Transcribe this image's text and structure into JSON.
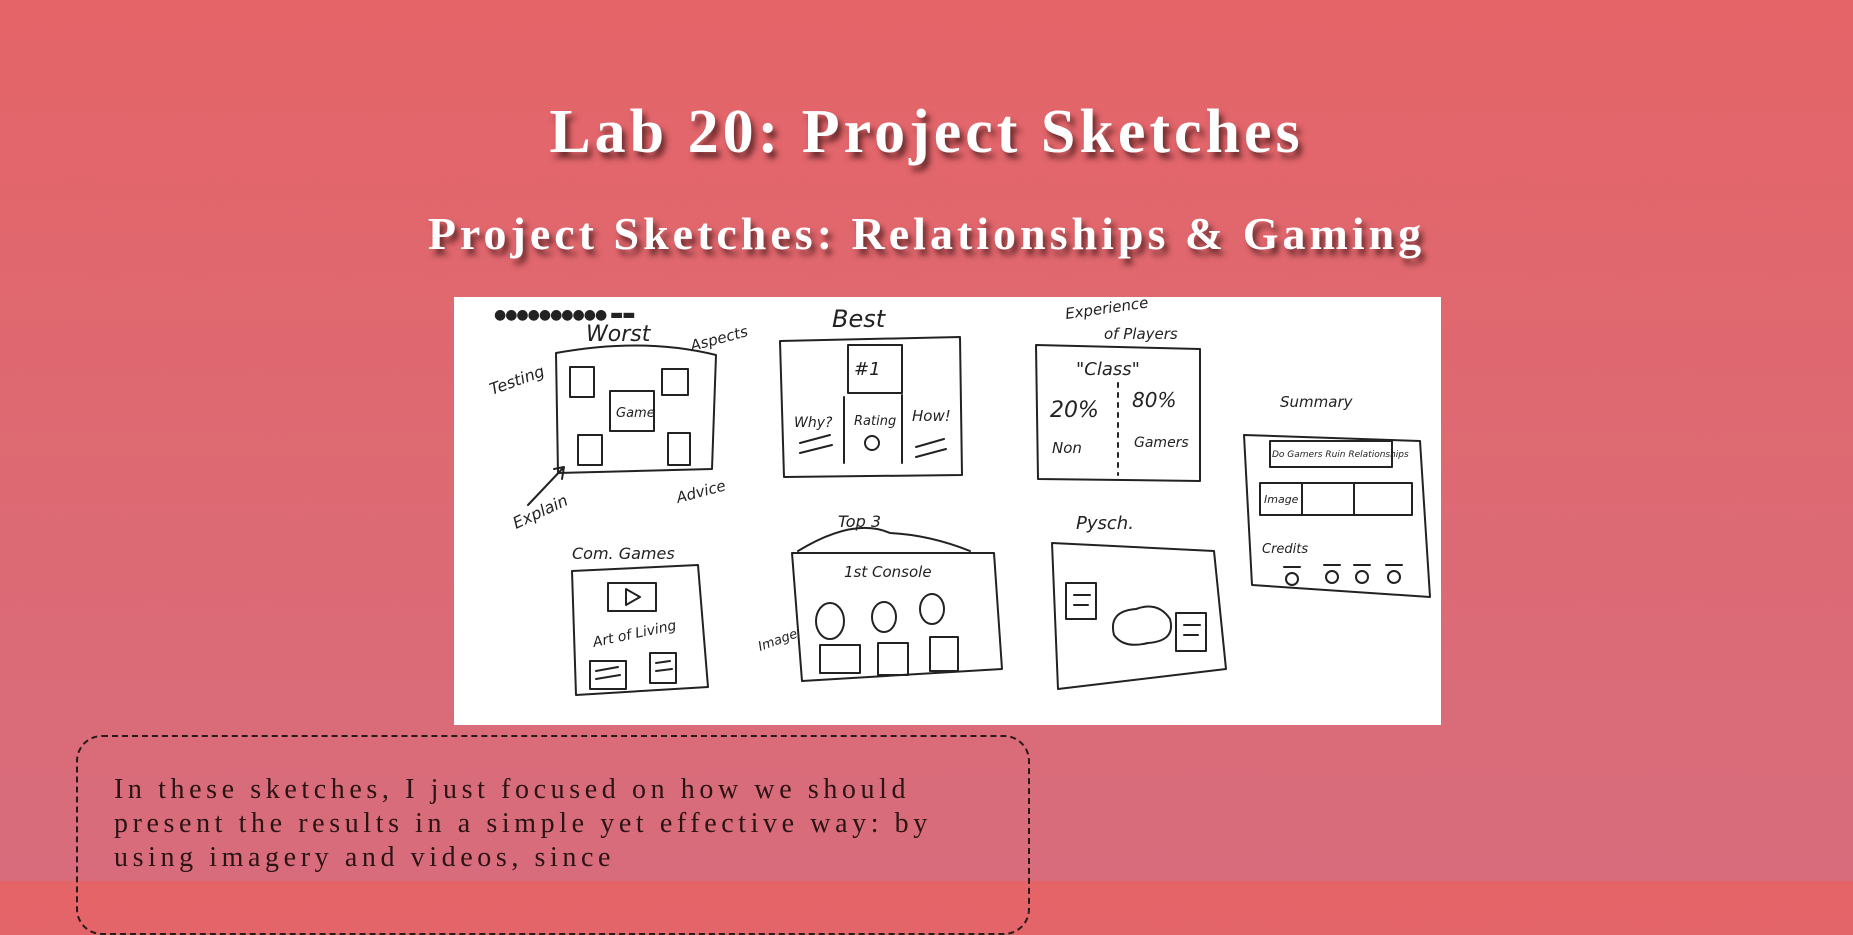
{
  "page": {
    "title": "Lab 20: Project Sketches",
    "subtitle": "Project Sketches: Relationships & Gaming"
  },
  "sketch": {
    "frames": [
      {
        "heading": "Worst",
        "notes": [
          "Testing",
          "Aspects",
          "Game",
          "Explain",
          "Advice"
        ]
      },
      {
        "heading": "Best",
        "notes": [
          "#1",
          "Why?",
          "Rating",
          "How!"
        ]
      },
      {
        "heading": "Experience of Players",
        "notes": [
          "\"Class\"",
          "20%",
          "80%",
          "Non",
          "Gamers"
        ]
      },
      {
        "heading": "Summary",
        "notes": [
          "Do Gamers Ruin Relationships",
          "Image",
          "Credits"
        ]
      },
      {
        "heading": "Com. Games",
        "notes": [
          "Art of Living"
        ]
      },
      {
        "heading": "Top 3",
        "notes": [
          "1st Console",
          "Image"
        ]
      },
      {
        "heading": "Pysch.",
        "notes": []
      }
    ]
  },
  "description": {
    "text": "In these sketches, I just focused on how we should present the results in a simple yet effective way: by using imagery and videos, since"
  },
  "colors": {
    "background_top": "#e46468",
    "background_bottom": "#d86c7c",
    "heading_text": "#ffffff",
    "body_text": "#2a1414"
  }
}
